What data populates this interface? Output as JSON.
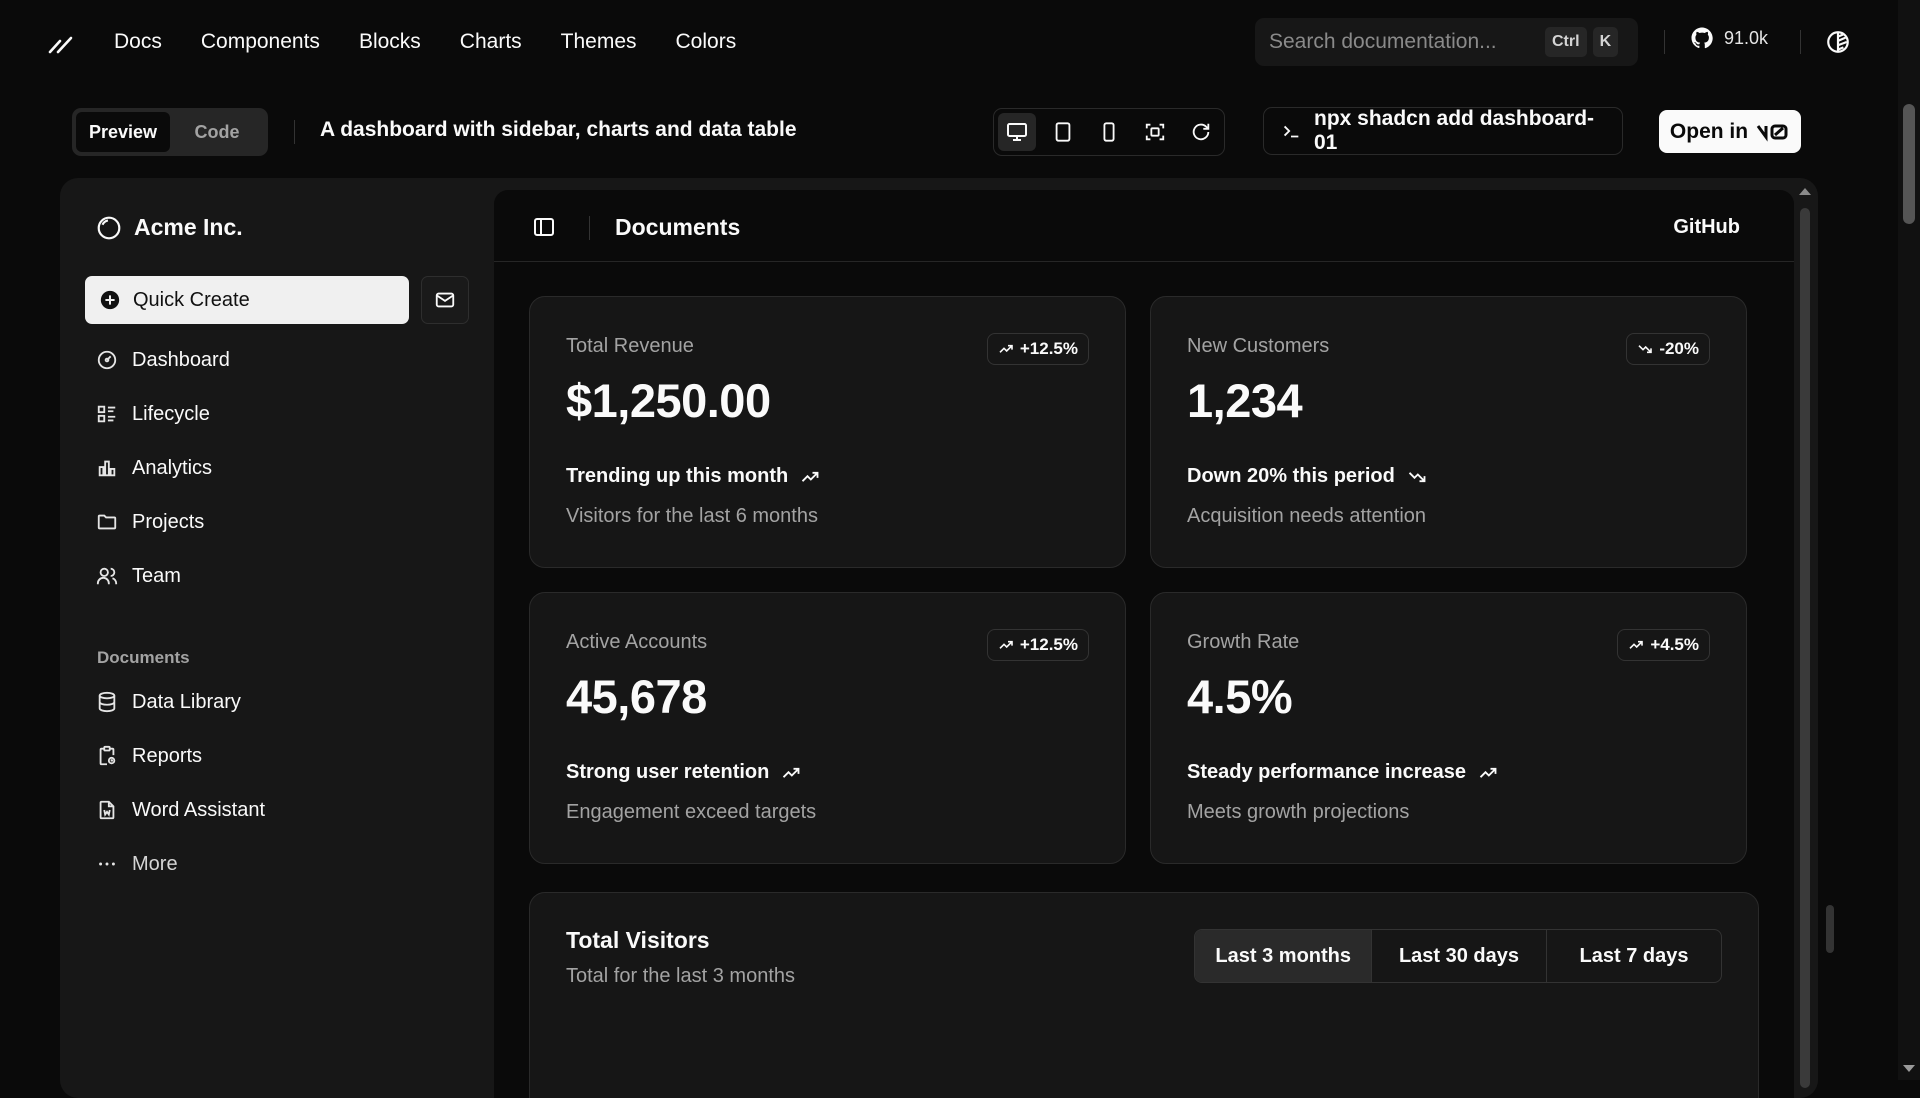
{
  "nav": {
    "links": [
      "Docs",
      "Components",
      "Blocks",
      "Charts",
      "Themes",
      "Colors"
    ],
    "search_placeholder": "Search documentation...",
    "kbd_ctrl": "Ctrl",
    "kbd_k": "K",
    "github_stars": "91.0k"
  },
  "toolbar": {
    "preview_label": "Preview",
    "code_label": "Code",
    "description": "A dashboard with sidebar, charts and data table",
    "command": "npx shadcn add dashboard-01",
    "open_in_label": "Open in"
  },
  "sidebar": {
    "brand": "Acme Inc.",
    "quick_create": "Quick Create",
    "items": [
      "Dashboard",
      "Lifecycle",
      "Analytics",
      "Projects",
      "Team"
    ],
    "documents_title": "Documents",
    "doc_items": [
      "Data Library",
      "Reports",
      "Word Assistant",
      "More"
    ]
  },
  "main": {
    "title": "Documents",
    "github_link": "GitHub",
    "cards": [
      {
        "label": "Total Revenue",
        "value": "$1,250.00",
        "badge": "+12.5%",
        "direction": "up",
        "trend": "Trending up this month",
        "sub": "Visitors for the last 6 months"
      },
      {
        "label": "New Customers",
        "value": "1,234",
        "badge": "-20%",
        "direction": "down",
        "trend": "Down 20% this period",
        "sub": "Acquisition needs attention"
      },
      {
        "label": "Active Accounts",
        "value": "45,678",
        "badge": "+12.5%",
        "direction": "up",
        "trend": "Strong user retention",
        "sub": "Engagement exceed targets"
      },
      {
        "label": "Growth Rate",
        "value": "4.5%",
        "badge": "+4.5%",
        "direction": "up",
        "trend": "Steady performance increase",
        "sub": "Meets growth projections"
      }
    ],
    "visitors": {
      "title": "Total Visitors",
      "subtitle": "Total for the last 3 months",
      "ranges": [
        "Last 3 months",
        "Last 30 days",
        "Last 7 days"
      ],
      "selected_range": "Last 3 months"
    }
  }
}
